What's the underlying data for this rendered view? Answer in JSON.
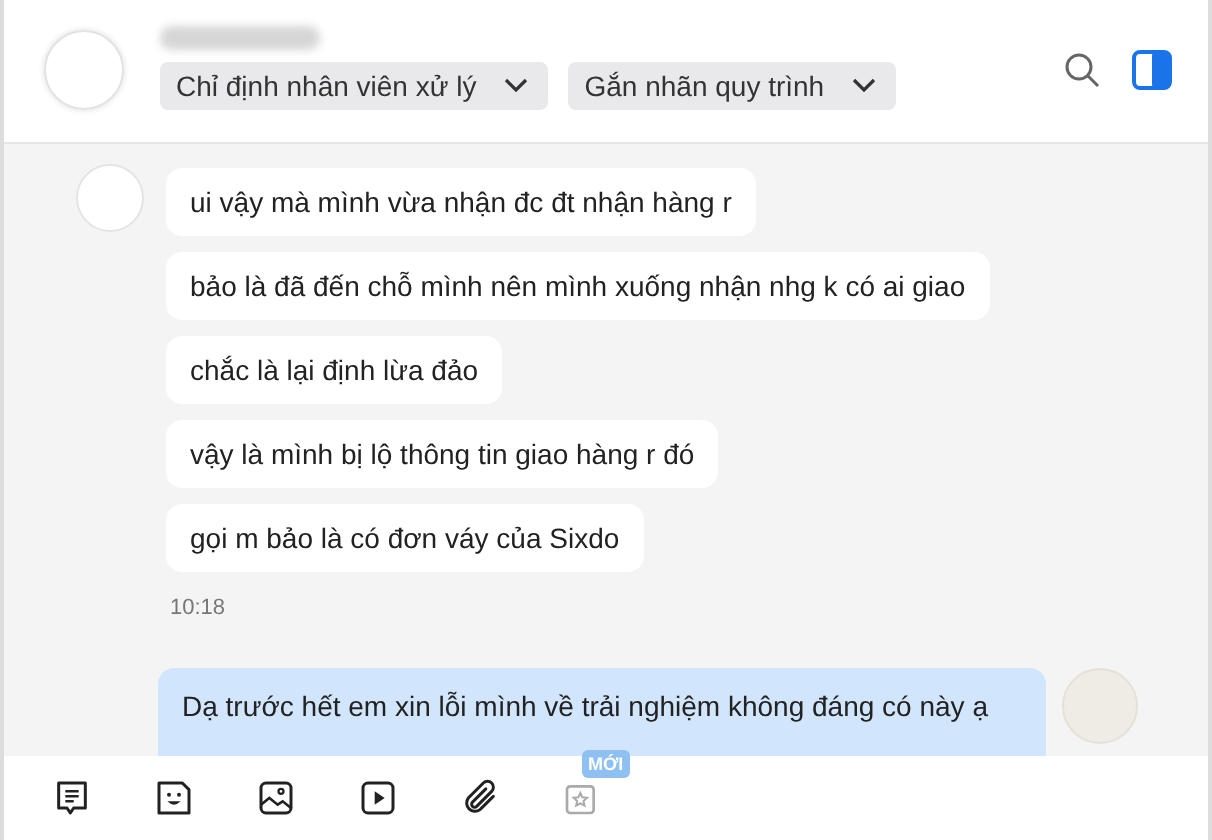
{
  "header": {
    "dropdowns": [
      {
        "label": "Chỉ định nhân viên xử lý"
      },
      {
        "label": "Gắn nhãn quy trình"
      }
    ]
  },
  "messages": [
    {
      "kind": "incoming",
      "text": "ui vậy mà mình vừa nhận đc đt nhận hàng r"
    },
    {
      "kind": "incoming",
      "text": "bảo là đã đến chỗ mình nên mình xuống nhận nhg k có ai giao"
    },
    {
      "kind": "incoming",
      "text": "chắc là lại định lừa đảo"
    },
    {
      "kind": "incoming",
      "text": "vậy là mình bị lộ thông tin giao hàng r đó"
    },
    {
      "kind": "incoming",
      "text": "gọi m bảo là có đơn váy của Sixdo"
    },
    {
      "kind": "time",
      "text": "10:18"
    },
    {
      "kind": "outgoing",
      "text": "Dạ trước hết em xin lỗi mình về trải nghiệm không đáng có này ạ"
    }
  ],
  "toolbar": {
    "new_badge": "MỚI"
  }
}
